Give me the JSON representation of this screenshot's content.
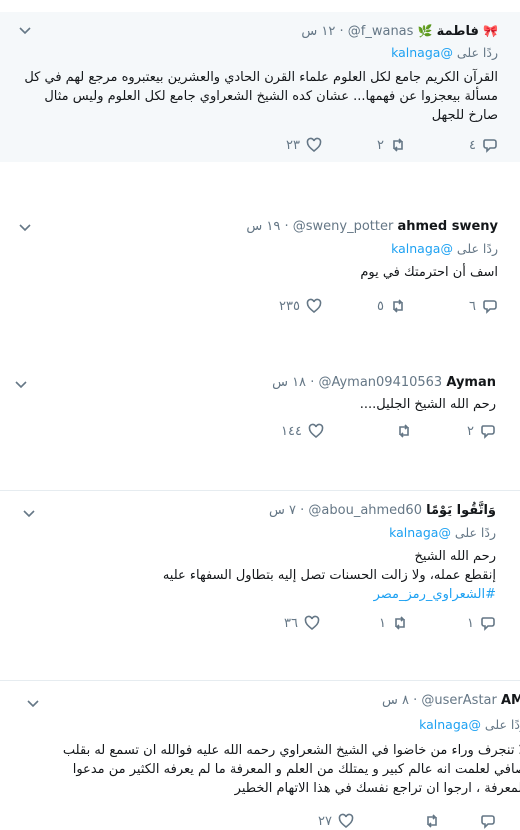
{
  "tweets": [
    {
      "name": "فاطمة",
      "handle": "@f_wanas",
      "time": "١٢ س",
      "reply_prefix": "ردًا على",
      "reply_mention": "@kalnaga",
      "body_lines": [
        "القرآن الكريم جامع لكل العلوم علماء القرن الحادي والعشرين بيعتبروه مرجع لهم في كل",
        "مسألة بيعجزوا عن فهمها... عشان كده الشيخ الشعراوي جامع لكل العلوم وليس مثال",
        "صارخ للجهل"
      ],
      "reply_count": "٤",
      "retweet_count": "٢",
      "like_count": "٢٣"
    },
    {
      "name": "ahmed sweny",
      "handle": "@sweny_potter",
      "time": "١٩ س",
      "reply_prefix": "ردًا على",
      "reply_mention": "@kalnaga",
      "body_lines": [
        "اسف أن احترمتك في يوم"
      ],
      "reply_count": "٦",
      "retweet_count": "٥",
      "like_count": "٢٣٥"
    },
    {
      "name": "Ayman",
      "handle": "@Ayman09410563",
      "time": "١٨ س",
      "body_lines": [
        "رحم الله الشيخ الجليل...."
      ],
      "reply_count": "٢",
      "retweet_count": "",
      "like_count": "١٤٤"
    },
    {
      "name": "وَاتَّقُوا يَوْمًا",
      "handle": "@abou_ahmed60",
      "time": "٧ س",
      "reply_prefix": "ردًا على",
      "reply_mention": "@kalnaga",
      "body_lines": [
        "رحم الله الشيخ",
        "إنقطع عمله، ولا زالت الحسنات تصل إليه بتطاول السفهاء عليه"
      ],
      "hashtag": "#الشعراوي_رمز_مصر",
      "reply_count": "١",
      "retweet_count": "١",
      "like_count": "٣٦"
    },
    {
      "name": "AM",
      "handle": "@userAstar",
      "time": "٨ س",
      "reply_prefix": "ردًا على",
      "reply_mention": "@kalnaga",
      "body_lines": [
        "لا تنجرف وراء من خاضوا في الشيخ الشعراوي رحمه الله عليه فوالله ان تسمع له بقلب",
        "صافي لعلمت انه عالم كبير و يمتلك من العلم و المعرفة ما لم يعرفه الكثير من مدعوا",
        "المعرفة ، ارجوا ان تراجع نفسك في هذا الاتهام الخطير"
      ],
      "reply_count": "",
      "retweet_count": "",
      "like_count": "٢٧"
    }
  ],
  "icons": {
    "reply": "reply-icon",
    "retweet": "retweet-icon",
    "like": "heart-icon",
    "more": "chevron-down-icon"
  },
  "colors": {
    "link": "#1da1f2",
    "muted": "#657786",
    "highlight_bg": "#f5f8fa"
  }
}
